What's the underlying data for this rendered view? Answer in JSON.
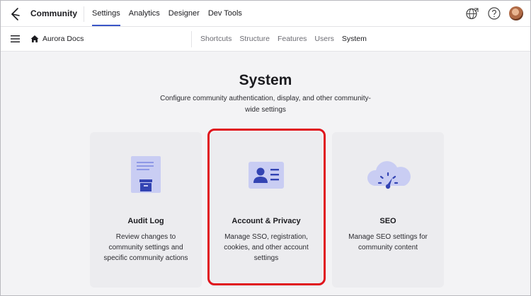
{
  "app": {
    "title": "Community"
  },
  "topnav": {
    "tabs": [
      {
        "label": "Settings",
        "active": true
      },
      {
        "label": "Analytics",
        "active": false
      },
      {
        "label": "Designer",
        "active": false
      },
      {
        "label": "Dev Tools",
        "active": false
      }
    ],
    "icons": [
      "globe-icon",
      "help-icon",
      "avatar"
    ]
  },
  "subnav": {
    "breadcrumb": "Aurora Docs",
    "tabs": [
      {
        "label": "Shortcuts",
        "active": false
      },
      {
        "label": "Structure",
        "active": false
      },
      {
        "label": "Features",
        "active": false
      },
      {
        "label": "Users",
        "active": false
      },
      {
        "label": "System",
        "active": true
      }
    ]
  },
  "main": {
    "title": "System",
    "description": "Configure community authentication, display, and other community-wide settings",
    "cards": [
      {
        "title": "Audit Log",
        "description": "Review changes to community settings and specific community actions",
        "icon": "audit-log-icon"
      },
      {
        "title": "Account & Privacy",
        "description": "Manage SSO, registration, cookies, and other account settings",
        "icon": "id-card-icon"
      },
      {
        "title": "SEO",
        "description": "Manage SEO settings for community content",
        "icon": "cloud-gauge-icon"
      }
    ]
  },
  "colors": {
    "accent": "#3a56c7",
    "highlight": "#e0141c",
    "icon_light": "#c9cdf3",
    "icon_dark": "#3344b3"
  }
}
